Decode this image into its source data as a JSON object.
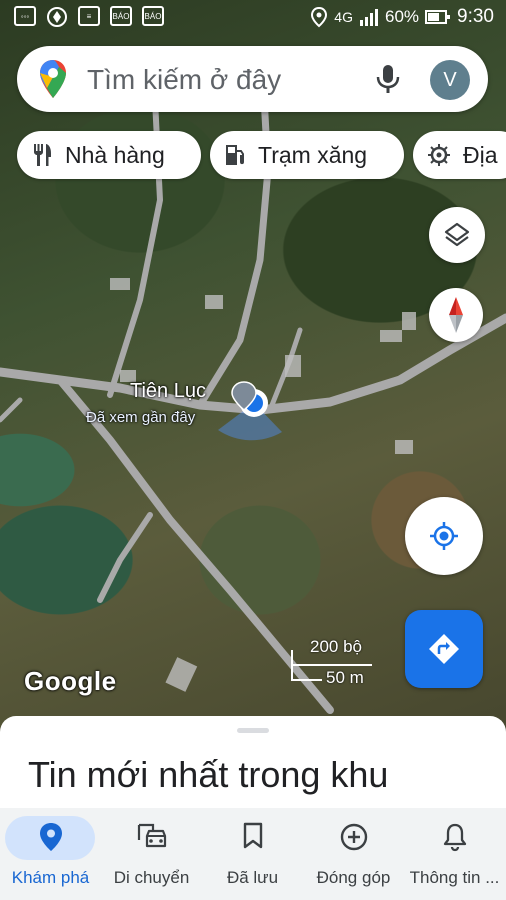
{
  "status_bar": {
    "network": "4G",
    "battery": "60%",
    "time": "9:30",
    "app_icons": [
      "messages-icon",
      "maps-icon",
      "document-icon",
      "news-icon-1",
      "news-icon-2"
    ]
  },
  "search": {
    "placeholder": "Tìm kiếm ở đây",
    "avatar_letter": "V"
  },
  "chips": [
    {
      "label": "Nhà hàng",
      "icon": "restaurant-icon"
    },
    {
      "label": "Trạm xăng",
      "icon": "gas-station-icon"
    },
    {
      "label": "Địa",
      "icon": "attraction-icon"
    }
  ],
  "map": {
    "place_name": "Tiên Lục",
    "place_subtitle": "Đã xem gần đây",
    "scale_imperial": "200 bộ",
    "scale_metric": "50 m",
    "attribution": "Google"
  },
  "sheet": {
    "title": "Tin mới nhất trong khu"
  },
  "bottom_nav": [
    {
      "label": "Khám phá",
      "icon": "explore-pin-icon",
      "active": true
    },
    {
      "label": "Di chuyển",
      "icon": "commute-car-icon",
      "active": false
    },
    {
      "label": "Đã lưu",
      "icon": "bookmark-icon",
      "active": false
    },
    {
      "label": "Đóng góp",
      "icon": "add-circle-icon",
      "active": false
    },
    {
      "label": "Thông tin ...",
      "icon": "bell-icon",
      "active": false
    }
  ],
  "colors": {
    "accent": "#1a73e8",
    "nav_active": "#1967d2",
    "nav_pill": "#d2e3fc"
  }
}
